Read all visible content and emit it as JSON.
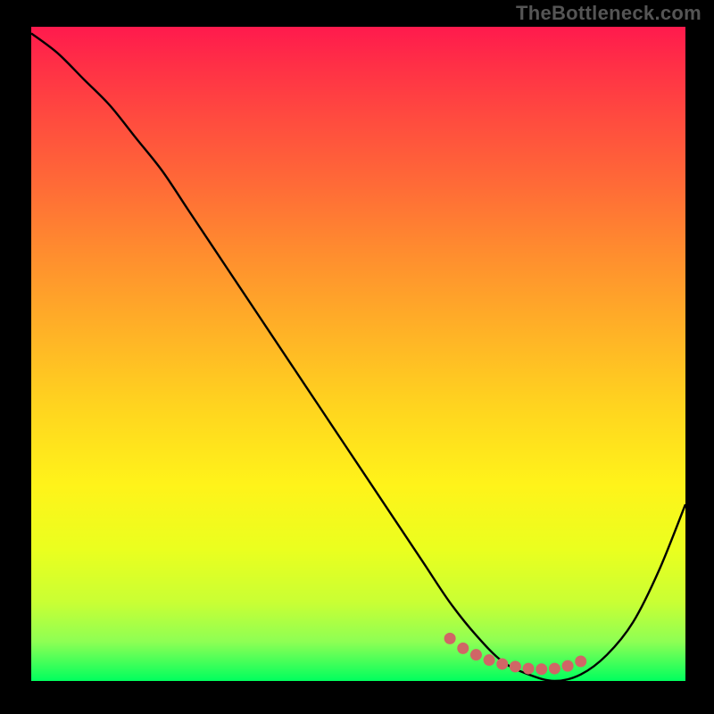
{
  "watermark": "TheBottleneck.com",
  "chart_data": {
    "type": "line",
    "title": "",
    "xlabel": "",
    "ylabel": "",
    "xlim": [
      0,
      100
    ],
    "ylim": [
      0,
      100
    ],
    "x": [
      0,
      4,
      8,
      12,
      16,
      20,
      24,
      28,
      32,
      36,
      40,
      44,
      48,
      52,
      56,
      60,
      64,
      68,
      72,
      76,
      80,
      84,
      88,
      92,
      96,
      100
    ],
    "y": [
      99,
      96,
      92,
      88,
      83,
      78,
      72,
      66,
      60,
      54,
      48,
      42,
      36,
      30,
      24,
      18,
      12,
      7,
      3,
      1,
      0,
      1,
      4,
      9,
      17,
      27
    ],
    "markers": {
      "color": "#d06666",
      "points": [
        {
          "x": 64,
          "y": 6.5
        },
        {
          "x": 66,
          "y": 5.0
        },
        {
          "x": 68,
          "y": 4.0
        },
        {
          "x": 70,
          "y": 3.2
        },
        {
          "x": 72,
          "y": 2.6
        },
        {
          "x": 74,
          "y": 2.2
        },
        {
          "x": 76,
          "y": 1.9
        },
        {
          "x": 78,
          "y": 1.8
        },
        {
          "x": 80,
          "y": 1.9
        },
        {
          "x": 82,
          "y": 2.3
        },
        {
          "x": 84,
          "y": 3.0
        }
      ]
    },
    "gradient_stops": [
      {
        "pct": 0,
        "color": "#ff1a4d"
      },
      {
        "pct": 50,
        "color": "#ffd41f"
      },
      {
        "pct": 100,
        "color": "#00ff5e"
      }
    ]
  }
}
